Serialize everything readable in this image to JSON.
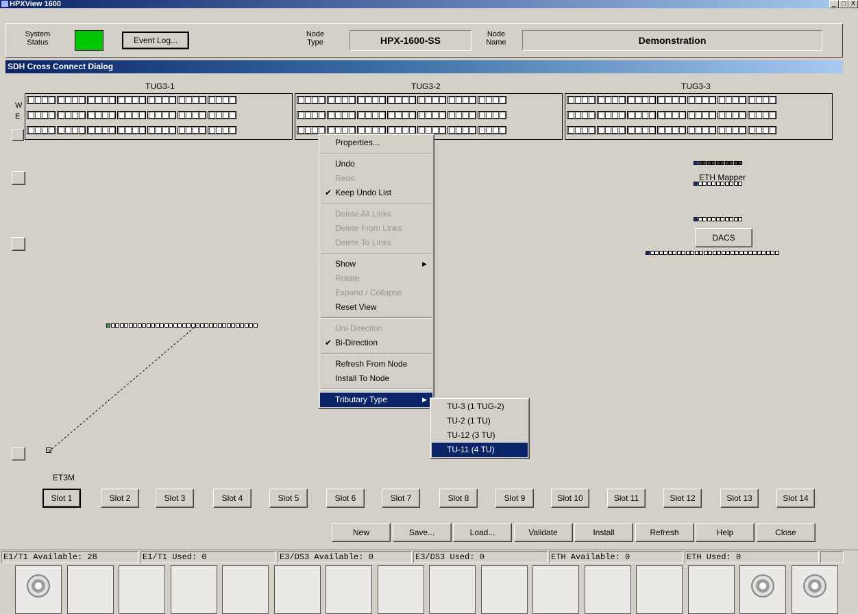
{
  "window": {
    "title": "HPXView 1600",
    "controls": [
      "_",
      "□",
      "X"
    ]
  },
  "header": {
    "system_status_label": "System Status",
    "system_status_color": "#00c800",
    "event_log_button": "Event Log...",
    "node_type_label": "Node Type",
    "node_type_value": "HPX-1600-SS",
    "node_name_label": "Node Name",
    "node_name_value": "Demonstration"
  },
  "dialog": {
    "title": "SDH Cross Connect Dialog"
  },
  "tug_labels": [
    "TUG3-1",
    "TUG3-2",
    "TUG3-3"
  ],
  "row_labels": [
    "W",
    "E"
  ],
  "mappers": {
    "eth_label": "ETH Mapper",
    "dacs_button": "DACS",
    "card_label": "ET3M"
  },
  "context_menu": {
    "items": [
      {
        "label": "Properties...",
        "enabled": true
      },
      {
        "label": "Undo",
        "enabled": true
      },
      {
        "label": "Redo",
        "enabled": false
      },
      {
        "label": "Keep Undo List",
        "enabled": true,
        "checked": true
      },
      {
        "label": "Delete All Links",
        "enabled": false
      },
      {
        "label": "Delete From Links",
        "enabled": false
      },
      {
        "label": "Delete To Links",
        "enabled": false
      },
      {
        "label": "Show",
        "enabled": true,
        "submenu": true
      },
      {
        "label": "Rotate",
        "enabled": false
      },
      {
        "label": "Expand / Collapse",
        "enabled": false
      },
      {
        "label": "Reset View",
        "enabled": true
      },
      {
        "label": "Uni-Direction",
        "enabled": false
      },
      {
        "label": "Bi-Direction",
        "enabled": true,
        "checked": true
      },
      {
        "label": "Refresh From Node",
        "enabled": true
      },
      {
        "label": "Install To Node",
        "enabled": true
      },
      {
        "label": "Tributary Type",
        "enabled": true,
        "submenu": true,
        "selected": true
      }
    ]
  },
  "tributary_submenu": {
    "items": [
      {
        "label": "TU-3 (1 TUG-2)"
      },
      {
        "label": "TU-2 (1 TU)"
      },
      {
        "label": "TU-12 (3 TU)"
      },
      {
        "label": "TU-11 (4 TU)",
        "selected": true
      }
    ]
  },
  "slots": [
    "Slot 1",
    "Slot 2",
    "Slot 3",
    "Slot 4",
    "Slot 5",
    "Slot 6",
    "Slot 7",
    "Slot 8",
    "Slot 9",
    "Slot 10",
    "Slot 11",
    "Slot 12",
    "Slot 13",
    "Slot 14"
  ],
  "actions": [
    "New",
    "Save...",
    "Load...",
    "Validate",
    "Install",
    "Refresh",
    "Help",
    "Close"
  ],
  "status_bar": {
    "e1t1_available": "E1/T1 Available: 28",
    "e1t1_used": "E1/T1 Used: 0",
    "e3ds3_available": "E3/DS3 Available: 0",
    "e3ds3_used": "E3/DS3 Used: 0",
    "eth_available": "ETH Available: 0",
    "eth_used": "ETH Used: 0"
  }
}
